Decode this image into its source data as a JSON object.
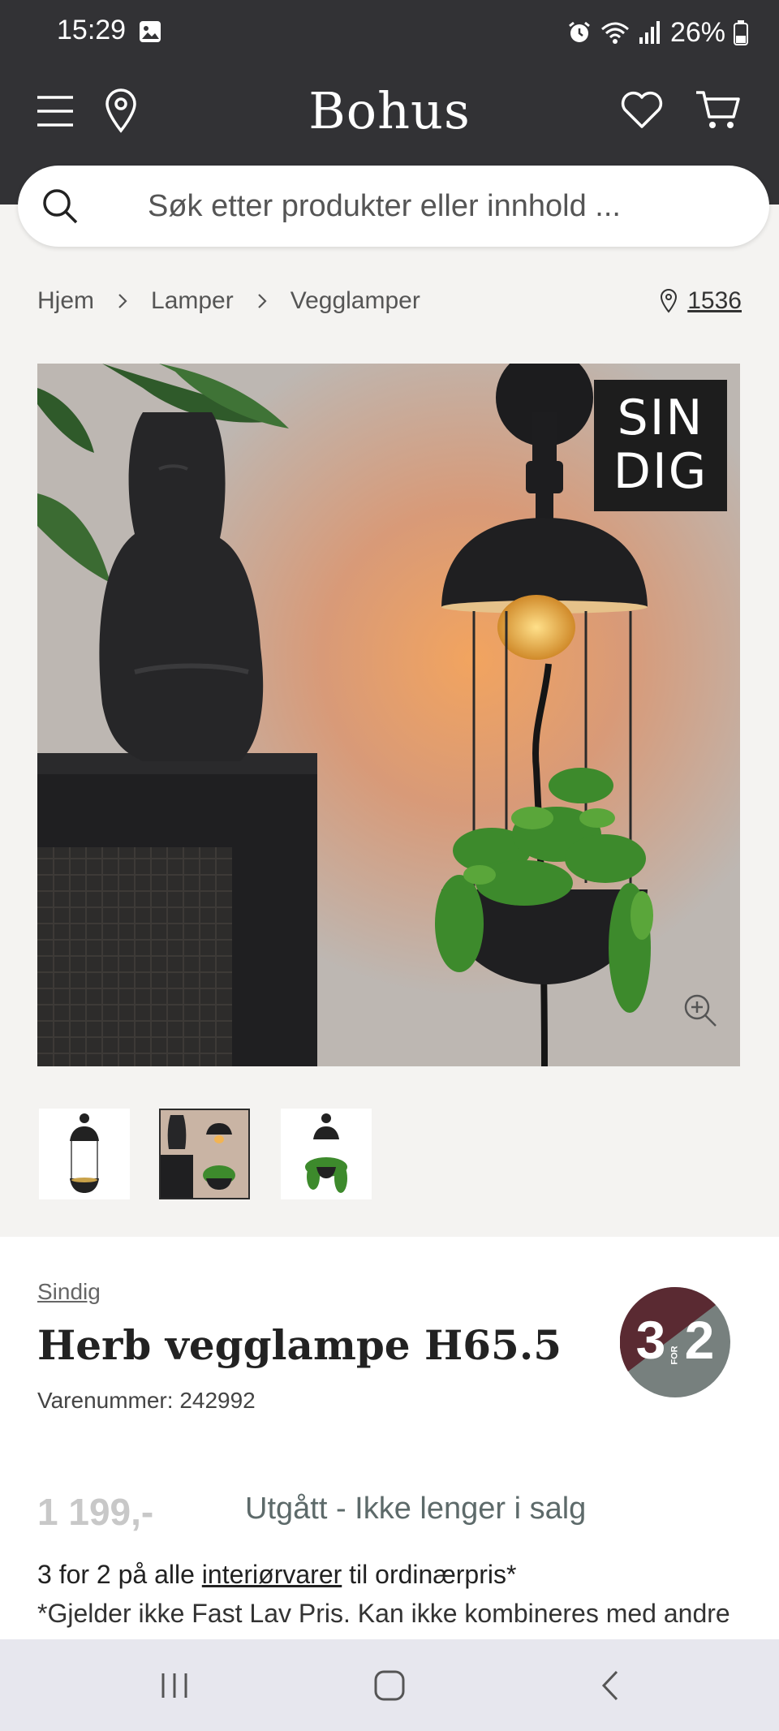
{
  "status_bar": {
    "time": "15:29",
    "battery": "26%"
  },
  "header": {
    "logo": "Bohus"
  },
  "search": {
    "placeholder": "Søk etter produkter eller innhold ..."
  },
  "breadcrumb": {
    "items": [
      "Hjem",
      "Lamper",
      "Vegglamper"
    ],
    "store_id": "1536"
  },
  "gallery": {
    "brand_badge_line1": "SIN",
    "brand_badge_line2": "DIG",
    "thumbnail_count": 3,
    "active_thumbnail": 2
  },
  "product": {
    "brand": "Sindig",
    "title": "Herb vegglampe H65.5",
    "sku": "Varenummer: 242992",
    "price": "1 199,-",
    "availability": "Utgått - Ikke lenger i salg",
    "promo_badge": {
      "big": "3",
      "small": "FOR",
      "big2": "2"
    },
    "offer_prefix": "3 for 2 på alle ",
    "offer_link": "interiørvarer",
    "offer_suffix": " til ordinærpris*",
    "disclaimer": "*Gjelder ikke Fast Lav Pris. Kan ikke kombineres med andre"
  },
  "colors": {
    "header_bg": "#323235",
    "promo_left": "#5a2a32",
    "promo_right": "#77807e",
    "availability": "#5d6a6a"
  }
}
